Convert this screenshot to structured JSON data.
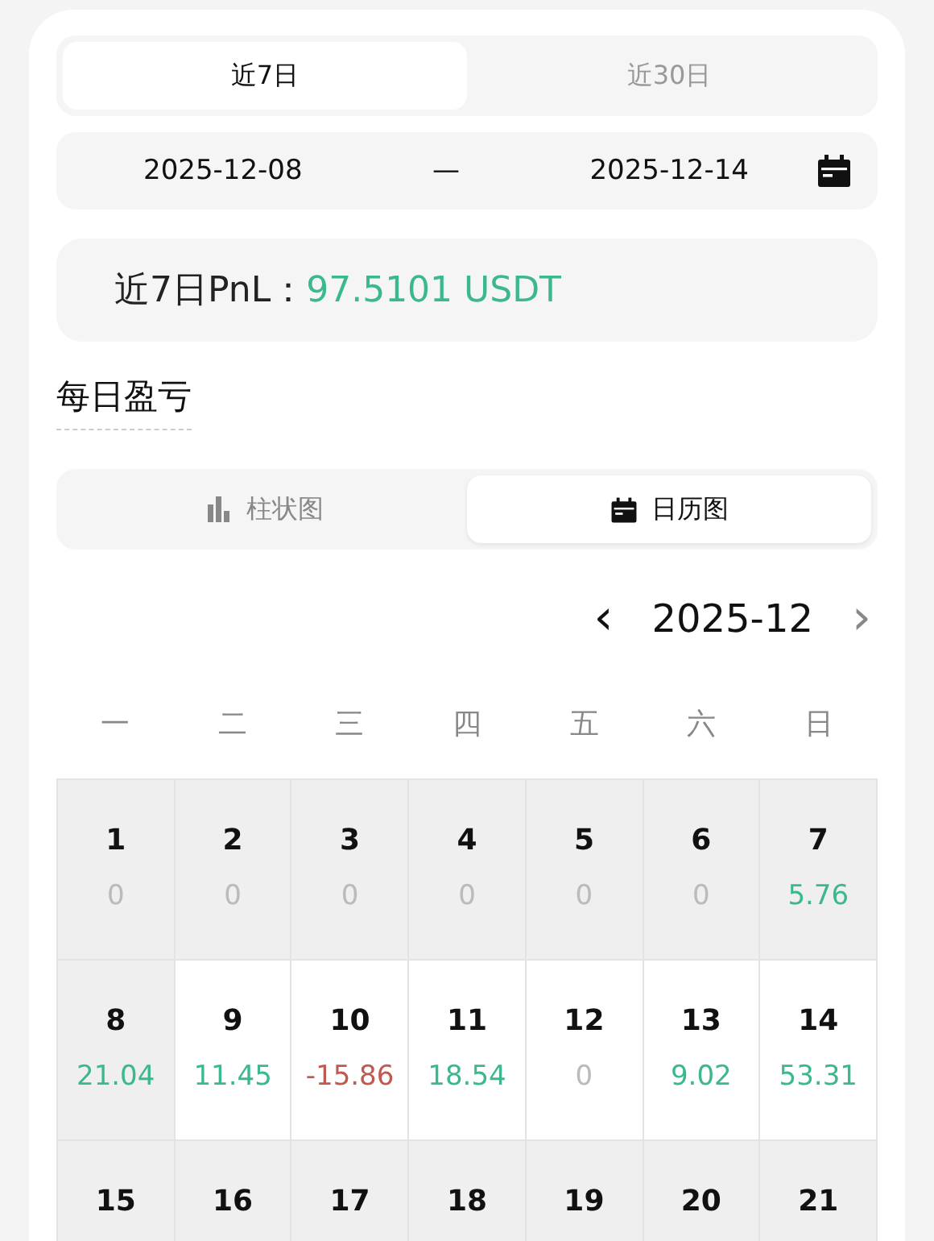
{
  "period_tabs": [
    {
      "label": "近7日",
      "selected": true
    },
    {
      "label": "近30日",
      "selected": false
    }
  ],
  "date_range": {
    "start": "2025-12-08",
    "separator": "—",
    "end": "2025-12-14"
  },
  "pnl": {
    "label": "近7日PnL：",
    "value": "97.5101 USDT"
  },
  "section_title": "每日盈亏",
  "view_tabs": [
    {
      "label": "柱状图",
      "kind": "bar",
      "selected": false
    },
    {
      "label": "日历图",
      "kind": "calendar",
      "selected": true
    }
  ],
  "month": {
    "prev": "‹",
    "label": "2025-12",
    "next": "›"
  },
  "weekdays": [
    "一",
    "二",
    "三",
    "四",
    "五",
    "六",
    "日"
  ],
  "days": [
    {
      "day": "1",
      "value": "0",
      "kind": "zero",
      "in_range": false
    },
    {
      "day": "2",
      "value": "0",
      "kind": "zero",
      "in_range": false
    },
    {
      "day": "3",
      "value": "0",
      "kind": "zero",
      "in_range": false
    },
    {
      "day": "4",
      "value": "0",
      "kind": "zero",
      "in_range": false
    },
    {
      "day": "5",
      "value": "0",
      "kind": "zero",
      "in_range": false
    },
    {
      "day": "6",
      "value": "0",
      "kind": "zero",
      "in_range": false
    },
    {
      "day": "7",
      "value": "5.76",
      "kind": "gain",
      "in_range": false
    },
    {
      "day": "8",
      "value": "21.04",
      "kind": "gain",
      "in_range": false
    },
    {
      "day": "9",
      "value": "11.45",
      "kind": "gain",
      "in_range": true
    },
    {
      "day": "10",
      "value": "-15.86",
      "kind": "loss",
      "in_range": true
    },
    {
      "day": "11",
      "value": "18.54",
      "kind": "gain",
      "in_range": true
    },
    {
      "day": "12",
      "value": "0",
      "kind": "zero",
      "in_range": true
    },
    {
      "day": "13",
      "value": "9.02",
      "kind": "gain",
      "in_range": true
    },
    {
      "day": "14",
      "value": "53.31",
      "kind": "gain",
      "in_range": true
    },
    {
      "day": "15",
      "in_range": false
    },
    {
      "day": "16",
      "in_range": false
    },
    {
      "day": "17",
      "in_range": false
    },
    {
      "day": "18",
      "in_range": false
    },
    {
      "day": "19",
      "in_range": false
    },
    {
      "day": "20",
      "in_range": false
    },
    {
      "day": "21",
      "in_range": false
    }
  ]
}
